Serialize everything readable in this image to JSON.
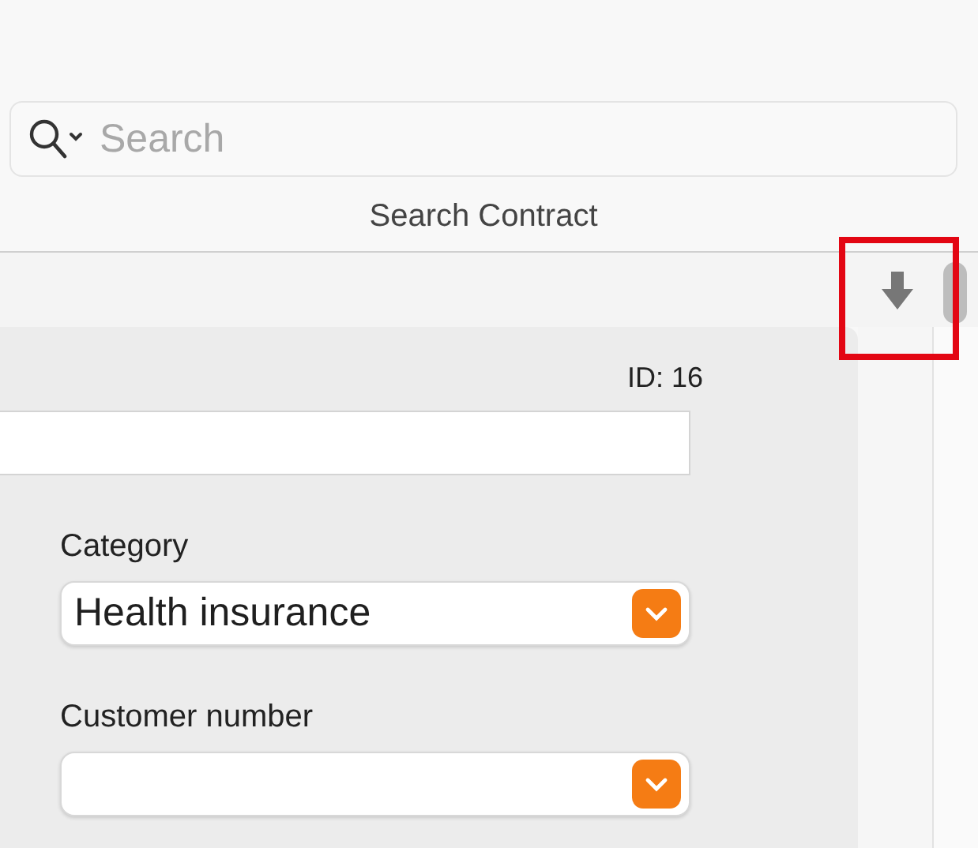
{
  "search": {
    "placeholder": "Search"
  },
  "title": "Search Contract",
  "toolbar": {
    "download_highlighted": true
  },
  "record": {
    "id_label": "ID: 16"
  },
  "fields": [
    {
      "kind": "text"
    },
    {
      "kind": "select",
      "label": "Category",
      "value": "Health insurance"
    },
    {
      "kind": "select",
      "label": "Customer number"
    }
  ]
}
